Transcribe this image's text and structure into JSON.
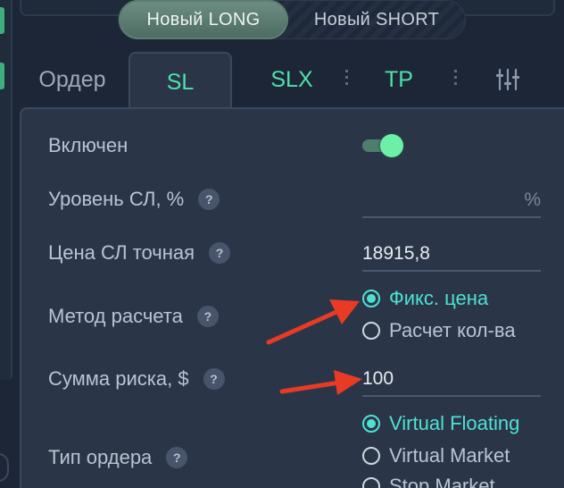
{
  "direction": {
    "long_label": "Новый LONG",
    "short_label": "Новый SHORT"
  },
  "tabs": {
    "order": "Ордер",
    "sl": "SL",
    "slx": "SLX",
    "tp": "TP"
  },
  "form": {
    "enabled": {
      "label": "Включен",
      "value": true
    },
    "sl_level": {
      "label": "Уровень СЛ, %",
      "value": "",
      "unit": "%"
    },
    "sl_price": {
      "label": "Цена СЛ точная",
      "value": "18915,8"
    },
    "calc_method": {
      "label": "Метод расчета",
      "options": [
        "Фикс. цена",
        "Расчет кол-ва"
      ],
      "selected": "Фикс. цена"
    },
    "risk_sum": {
      "label": "Сумма риска, $",
      "value": "100"
    },
    "order_type": {
      "label": "Тип ордера",
      "options": [
        "Virtual Floating",
        "Virtual Market",
        "Stop Market"
      ],
      "selected": "Virtual Floating"
    }
  },
  "help_glyph": "?",
  "colors": {
    "accent": "#4fe0ad",
    "radio_selected": "#4fe0d2",
    "arrow": "#e83a24",
    "panel": "#2a3648",
    "background": "#1c2636"
  }
}
